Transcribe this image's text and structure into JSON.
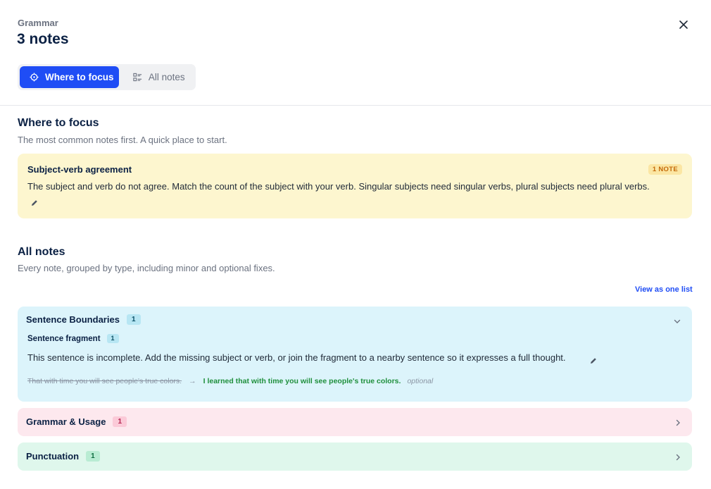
{
  "header": {
    "eyebrow": "Grammar",
    "title": "3 notes",
    "close_icon": "close-icon"
  },
  "tabs": [
    {
      "label": "Where to focus",
      "icon": "crosshair-icon",
      "active": true
    },
    {
      "label": "All notes",
      "icon": "list-icon",
      "active": false
    }
  ],
  "focus": {
    "title": "Where to focus",
    "subtitle": "The most common notes first. A quick place to start.",
    "card": {
      "heading": "Subject-verb agreement",
      "badge": "1 NOTE",
      "body": "The subject and verb do not agree. Match the count of the subject with your verb. Singular subjects need singular verbs, plural subjects need plural verbs.",
      "edit_icon": "pencil-icon"
    }
  },
  "all_notes": {
    "title": "All notes",
    "subtitle": "Every note, grouped by type, including minor and optional fixes.",
    "view_link": "View as one list",
    "groups": [
      {
        "name": "Sentence Boundaries",
        "count": "1",
        "expanded": true,
        "color": "#dcf4fb",
        "items": [
          {
            "name": "Sentence fragment",
            "count": "1",
            "body": "This sentence is incomplete. Add the missing subject or verb, or join the fragment to a nearby sentence so it expresses a full thought.",
            "example_old": "That with time you will see people's true colors.",
            "example_new": "I learned that with time you will see people's true colors.",
            "example_note": "optional"
          }
        ]
      },
      {
        "name": "Grammar & Usage",
        "count": "1",
        "expanded": false,
        "color": "#fde8ee"
      },
      {
        "name": "Punctuation",
        "count": "1",
        "expanded": false,
        "color": "#dff7ec"
      }
    ]
  },
  "colors": {
    "accent": "#1f4df5",
    "heading": "#0b2144",
    "focus_card": "#fdf6cf",
    "badge_text": "#c46a0a",
    "success_text": "#1f8f3c"
  }
}
